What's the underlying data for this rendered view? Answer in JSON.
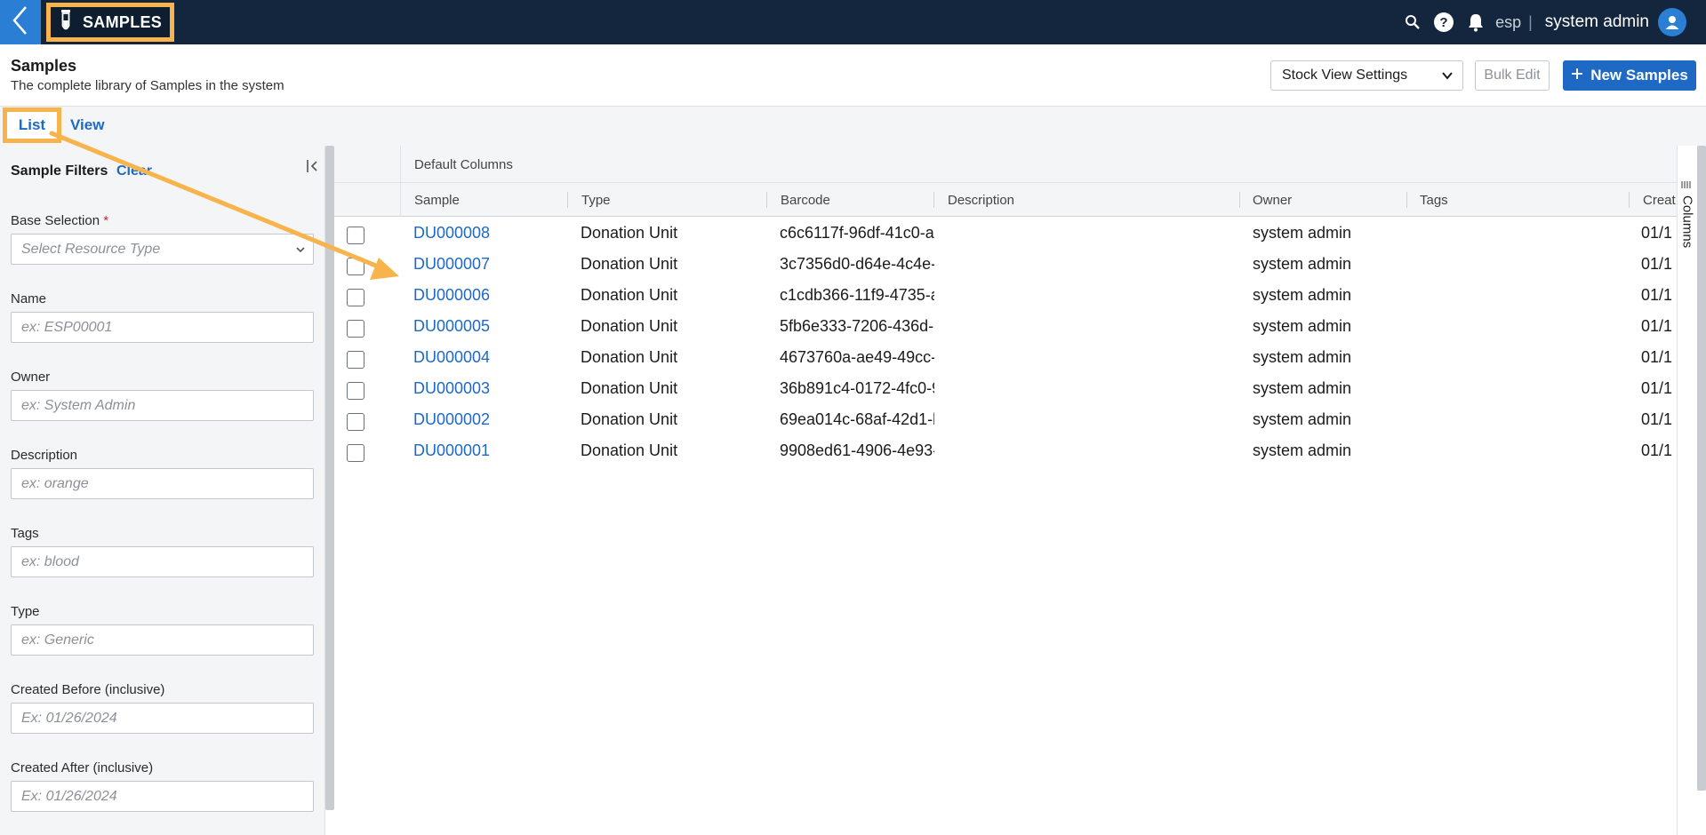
{
  "topbar": {
    "app_name": "SAMPLES",
    "tenant": "esp",
    "separator": "|",
    "user_name": "system admin",
    "icons": [
      "back-chevron-icon",
      "test-tube-icon",
      "search-icon",
      "help-icon",
      "bell-icon",
      "user-avatar-icon"
    ]
  },
  "header": {
    "title": "Samples",
    "subtitle": "The complete library of Samples in the system",
    "view_select": "Stock View Settings",
    "bulk_edit": "Bulk Edit",
    "new_samples": "New Samples"
  },
  "tabs": [
    {
      "label": "List",
      "active": true
    },
    {
      "label": "View",
      "active": false
    }
  ],
  "filters": {
    "title": "Sample Filters",
    "clear": "Clear",
    "fields": [
      {
        "label": "Base Selection",
        "required_mark": "*",
        "placeholder": "Select Resource Type",
        "type": "select"
      },
      {
        "label": "Name",
        "placeholder": "ex: ESP00001"
      },
      {
        "label": "Owner",
        "placeholder": "ex: System Admin"
      },
      {
        "label": "Description",
        "placeholder": "ex: orange"
      },
      {
        "label": "Tags",
        "placeholder": "ex: blood"
      },
      {
        "label": "Type",
        "placeholder": "ex: Generic"
      },
      {
        "label": "Created Before (inclusive)",
        "placeholder": "Ex: 01/26/2024"
      },
      {
        "label": "Created After (inclusive)",
        "placeholder": "Ex: 01/26/2024"
      }
    ]
  },
  "grid": {
    "group_label": "Default Columns",
    "columns": [
      "Sample",
      "Type",
      "Barcode",
      "Description",
      "Owner",
      "Tags",
      "Creat"
    ],
    "side_panel_label": "Columns",
    "rows": [
      {
        "sample": "DU000008",
        "type": "Donation Unit",
        "barcode": "c6c6117f-96df-41c0-a",
        "owner": "system admin",
        "created": "01/1"
      },
      {
        "sample": "DU000007",
        "type": "Donation Unit",
        "barcode": "3c7356d0-d64e-4c4e-",
        "owner": "system admin",
        "created": "01/1"
      },
      {
        "sample": "DU000006",
        "type": "Donation Unit",
        "barcode": "c1cdb366-11f9-4735-a",
        "owner": "system admin",
        "created": "01/1"
      },
      {
        "sample": "DU000005",
        "type": "Donation Unit",
        "barcode": "5fb6e333-7206-436d-",
        "owner": "system admin",
        "created": "01/1"
      },
      {
        "sample": "DU000004",
        "type": "Donation Unit",
        "barcode": "4673760a-ae49-49cc-",
        "owner": "system admin",
        "created": "01/1"
      },
      {
        "sample": "DU000003",
        "type": "Donation Unit",
        "barcode": "36b891c4-0172-4fc0-9",
        "owner": "system admin",
        "created": "01/1"
      },
      {
        "sample": "DU000002",
        "type": "Donation Unit",
        "barcode": "69ea014c-68af-42d1-b",
        "owner": "system admin",
        "created": "01/1"
      },
      {
        "sample": "DU000001",
        "type": "Donation Unit",
        "barcode": "9908ed61-4906-4e93-",
        "owner": "system admin",
        "created": "01/1"
      }
    ]
  },
  "colors": {
    "topbar": "#13263d",
    "accent_blue": "#1d69c4",
    "highlight_orange": "#f7b44c"
  }
}
